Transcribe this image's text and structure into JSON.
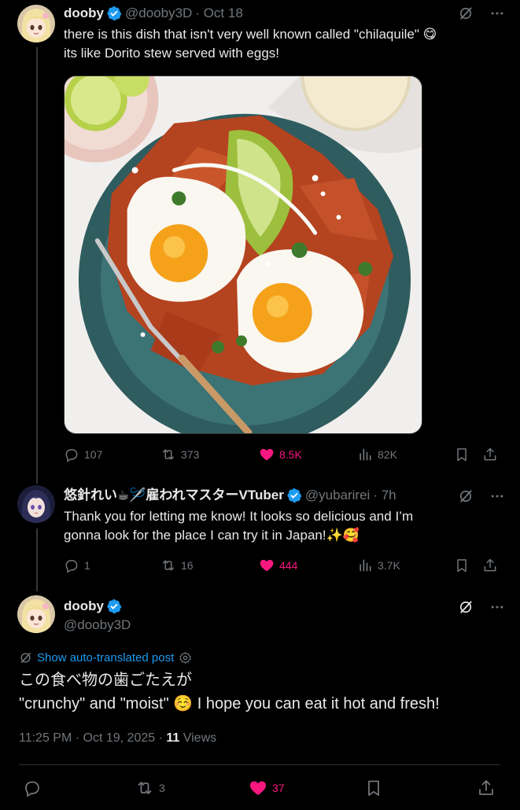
{
  "tweet1": {
    "name": "dooby",
    "handle": "@dooby3D",
    "date": "· Oct 18",
    "text_line1": "there is this dish that isn't very well known called \"chilaquile\" 😋",
    "text_line2": "its like Dorito stew served with eggs!",
    "stats": {
      "replies": "107",
      "reposts": "373",
      "likes": "8.5K",
      "views": "82K"
    }
  },
  "tweet2": {
    "name": "悠針れい☕🪡雇われマスターVTuber",
    "handle": "@yubarirei",
    "date": "· 7h",
    "text_line1": "Thank you for letting me know! It looks so delicious and I’m",
    "text_line2": "gonna look for the place I can try it in Japan!✨🥰",
    "stats": {
      "replies": "1",
      "reposts": "16",
      "likes": "444",
      "views": "3.7K"
    }
  },
  "tweet3": {
    "name": "dooby",
    "handle": "@dooby3D",
    "translate_label": "Show auto-translated post",
    "text_line1": "この食べ物の歯ごたえが",
    "text_line2": "\"crunchy\" and \"moist\" ☺️ I hope you can eat it hot and fresh!",
    "timestamp": "11:25 PM · Oct 19, 2025 · ",
    "views_count": "11",
    "views_label": " Views",
    "stats": {
      "replies": "",
      "reposts": "3",
      "likes": "37"
    }
  },
  "colors": {
    "accent": "#1d9bf0",
    "like": "#f91880",
    "muted": "#71767b",
    "text": "#e7e9ea"
  },
  "icons": [
    "grok-icon",
    "more-icon",
    "reply-icon",
    "repost-icon",
    "heart-icon",
    "views-icon",
    "bookmark-icon",
    "share-icon",
    "verified-icon",
    "settings-icon"
  ]
}
